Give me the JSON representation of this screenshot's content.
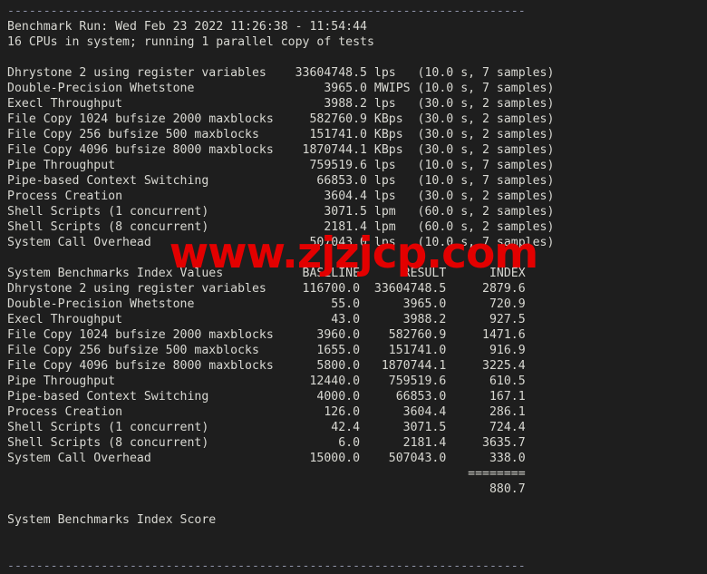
{
  "terminal": {
    "background_color": "#1e1e1e",
    "text_color": "#d8d8d2",
    "separator_color": "#8b8fa3",
    "separator_top": "------------------------------------------------------------------------",
    "separator_bottom": "------------------------------------------------------------------------",
    "header": {
      "run_line": "Benchmark Run: Wed Feb 23 2022 11:26:38 - 11:54:44",
      "cpu_line": "16 CPUs in system; running 1 parallel copy of tests"
    },
    "results": [
      {
        "name": "Dhrystone 2 using register variables",
        "value": "33604748.5",
        "unit": "lps",
        "timing": "(10.0 s, 7 samples)"
      },
      {
        "name": "Double-Precision Whetstone",
        "value": "3965.0",
        "unit": "MWIPS",
        "timing": "(10.0 s, 7 samples)"
      },
      {
        "name": "Execl Throughput",
        "value": "3988.2",
        "unit": "lps",
        "timing": "(30.0 s, 2 samples)"
      },
      {
        "name": "File Copy 1024 bufsize 2000 maxblocks",
        "value": "582760.9",
        "unit": "KBps",
        "timing": "(30.0 s, 2 samples)"
      },
      {
        "name": "File Copy 256 bufsize 500 maxblocks",
        "value": "151741.0",
        "unit": "KBps",
        "timing": "(30.0 s, 2 samples)"
      },
      {
        "name": "File Copy 4096 bufsize 8000 maxblocks",
        "value": "1870744.1",
        "unit": "KBps",
        "timing": "(30.0 s, 2 samples)"
      },
      {
        "name": "Pipe Throughput",
        "value": "759519.6",
        "unit": "lps",
        "timing": "(10.0 s, 7 samples)"
      },
      {
        "name": "Pipe-based Context Switching",
        "value": "66853.0",
        "unit": "lps",
        "timing": "(10.0 s, 7 samples)"
      },
      {
        "name": "Process Creation",
        "value": "3604.4",
        "unit": "lps",
        "timing": "(30.0 s, 2 samples)"
      },
      {
        "name": "Shell Scripts (1 concurrent)",
        "value": "3071.5",
        "unit": "lpm",
        "timing": "(60.0 s, 2 samples)"
      },
      {
        "name": "Shell Scripts (8 concurrent)",
        "value": "2181.4",
        "unit": "lpm",
        "timing": "(60.0 s, 2 samples)"
      },
      {
        "name": "System Call Overhead",
        "value": "507043.0",
        "unit": "lps",
        "timing": "(10.0 s, 7 samples)"
      }
    ],
    "index_table": {
      "title": "System Benchmarks Index Values",
      "columns": [
        "BASELINE",
        "RESULT",
        "INDEX"
      ],
      "rows": [
        {
          "name": "Dhrystone 2 using register variables",
          "baseline": "116700.0",
          "result": "33604748.5",
          "index": "2879.6"
        },
        {
          "name": "Double-Precision Whetstone",
          "baseline": "55.0",
          "result": "3965.0",
          "index": "720.9"
        },
        {
          "name": "Execl Throughput",
          "baseline": "43.0",
          "result": "3988.2",
          "index": "927.5"
        },
        {
          "name": "File Copy 1024 bufsize 2000 maxblocks",
          "baseline": "3960.0",
          "result": "582760.9",
          "index": "1471.6"
        },
        {
          "name": "File Copy 256 bufsize 500 maxblocks",
          "baseline": "1655.0",
          "result": "151741.0",
          "index": "916.9"
        },
        {
          "name": "File Copy 4096 bufsize 8000 maxblocks",
          "baseline": "5800.0",
          "result": "1870744.1",
          "index": "3225.4"
        },
        {
          "name": "Pipe Throughput",
          "baseline": "12440.0",
          "result": "759519.6",
          "index": "610.5"
        },
        {
          "name": "Pipe-based Context Switching",
          "baseline": "4000.0",
          "result": "66853.0",
          "index": "167.1"
        },
        {
          "name": "Process Creation",
          "baseline": "126.0",
          "result": "3604.4",
          "index": "286.1"
        },
        {
          "name": "Shell Scripts (1 concurrent)",
          "baseline": "42.4",
          "result": "3071.5",
          "index": "724.4"
        },
        {
          "name": "Shell Scripts (8 concurrent)",
          "baseline": "6.0",
          "result": "2181.4",
          "index": "3635.7"
        },
        {
          "name": "System Call Overhead",
          "baseline": "15000.0",
          "result": "507043.0",
          "index": "338.0"
        }
      ],
      "rule": "========",
      "score_label": "System Benchmarks Index Score",
      "score_value": "880.7"
    }
  },
  "watermark": {
    "text": "www.zjzjcp.com",
    "color": "#e30000"
  }
}
